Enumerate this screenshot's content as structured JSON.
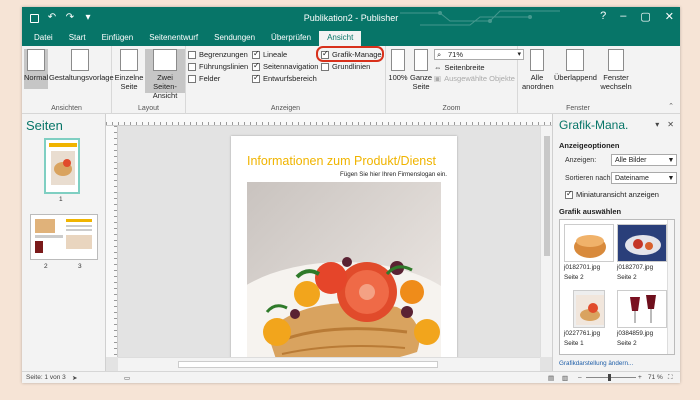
{
  "window": {
    "title": "Publikation2 - Publisher",
    "controls": {
      "help": "?",
      "minimize": "–",
      "restore": "▢",
      "close": "✕"
    }
  },
  "quick_access": {
    "save_icon": "save-icon",
    "undo_glyph": "↶",
    "redo_glyph": "↷",
    "more_glyph": "▾"
  },
  "tabs": [
    "Datei",
    "Start",
    "Einfügen",
    "Seitenentwurf",
    "Sendungen",
    "Überprüfen",
    "Ansicht"
  ],
  "active_tab": "Ansicht",
  "ribbon": {
    "ansichten": {
      "label": "Ansichten",
      "normal": "Normal",
      "gestaltungsvorlage": "Gestaltungsvorlage"
    },
    "layout": {
      "label": "Layout",
      "einzelne_seite": [
        "Einzelne",
        "Seite"
      ],
      "zwei_seiten": [
        "Zwei Seiten-",
        "Ansicht"
      ]
    },
    "anzeigen": {
      "label": "Anzeigen",
      "checkboxes": [
        {
          "label": "Begrenzungen",
          "checked": false
        },
        {
          "label": "Führungslinien",
          "checked": false
        },
        {
          "label": "Felder",
          "checked": false
        },
        {
          "label": "Lineale",
          "checked": true
        },
        {
          "label": "Seitennavigation",
          "checked": true
        },
        {
          "label": "Entwurfsbereich",
          "checked": true
        },
        {
          "label": "Grafik-Manager",
          "checked": true
        },
        {
          "label": "Grundlinien",
          "checked": false
        }
      ]
    },
    "zoom": {
      "label": "Zoom",
      "hundred": "100%",
      "ganze_seite": [
        "Ganze",
        "Seite"
      ],
      "value": "71%",
      "seitenbreite": "Seitenbreite",
      "ausgewaehlte": "Ausgewählte Objekte"
    },
    "fenster": {
      "label": "Fenster",
      "alle_anordnen": [
        "Alle",
        "anordnen"
      ],
      "ueberlappend": "Überlappend",
      "fenster_wechseln": [
        "Fenster",
        "wechseln"
      ]
    }
  },
  "pages_pane": {
    "title": "Seiten",
    "page_numbers": [
      "1",
      "2",
      "3"
    ]
  },
  "document": {
    "heading": "Informationen zum Produkt/Dienst",
    "slogan": "Fügen Sie hier Ihren Firmenslogan ein."
  },
  "graphics_manager": {
    "title": "Grafik-Mana.",
    "options_heading": "Anzeigeoptionen",
    "show_label": "Anzeigen:",
    "show_value": "Alle Bilder",
    "sort_label": "Sortieren nach:",
    "sort_value": "Dateiname",
    "thumbnail_label": "Miniaturansicht anzeigen",
    "thumbnail_checked": true,
    "select_heading": "Grafik auswählen",
    "items": [
      {
        "file": "j0182701.jpg",
        "page": "Seite 2"
      },
      {
        "file": "j0182707.jpg",
        "page": "Seite 2"
      },
      {
        "file": "j0227761.jpg",
        "page": "Seite 1"
      },
      {
        "file": "j0384859.jpg",
        "page": "Seite 2"
      }
    ],
    "link": "Grafikdarstellung ändern..."
  },
  "status": {
    "page": "Seite: 1 von 3",
    "zoom": "71 %"
  },
  "colors": {
    "accent": "#077568",
    "highlight": "#d8301b",
    "heading": "#f0b400"
  }
}
